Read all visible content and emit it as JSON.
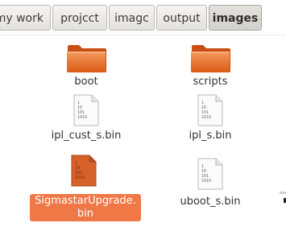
{
  "breadcrumbs": [
    {
      "label": "my work"
    },
    {
      "label": "projcct"
    },
    {
      "label": "imagc"
    },
    {
      "label": "output"
    },
    {
      "label": "images"
    }
  ],
  "files": [
    {
      "name": "boot",
      "icon": "folder-icon"
    },
    {
      "name": "scripts",
      "icon": "folder-icon"
    },
    {
      "name": "ipl_cust_s.bin",
      "icon": "binary-file-icon"
    },
    {
      "name": "ipl_s.bin",
      "icon": "binary-file-icon"
    },
    {
      "name": "SigmastarUpgrade.",
      "name_line2": "bin",
      "icon": "binary-file-icon",
      "selected": true
    },
    {
      "name": "uboot_s.bin",
      "icon": "binary-file-icon"
    }
  ],
  "binary_icon_text": [
    "1",
    "10",
    "101",
    "1010"
  ],
  "colors": {
    "folder": "#e2621b",
    "selection": "#f07746",
    "text": "#333333"
  }
}
